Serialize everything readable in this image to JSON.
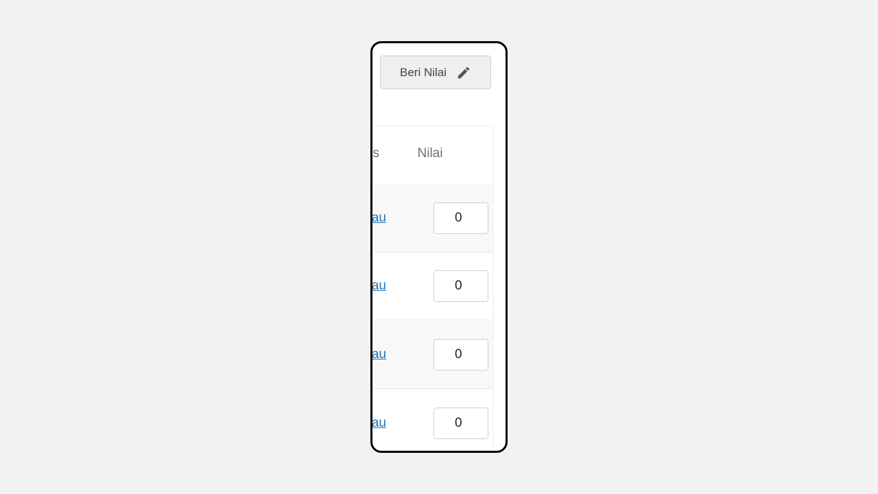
{
  "toolbar": {
    "grade_button_label": "Beri Nilai",
    "grade_button_icon": "pencil-icon"
  },
  "table": {
    "columns": {
      "cut_column_header": "s",
      "score_column_header": "Nilai"
    },
    "rows": [
      {
        "link_text": "au",
        "score": "0"
      },
      {
        "link_text": "au",
        "score": "0"
      },
      {
        "link_text": "au",
        "score": "0"
      },
      {
        "link_text": "au",
        "score": "0"
      }
    ]
  },
  "colors": {
    "link": "#1f73b7",
    "header_text": "#6f6f6f",
    "button_bg": "#f0efef",
    "device_border": "#000000"
  }
}
